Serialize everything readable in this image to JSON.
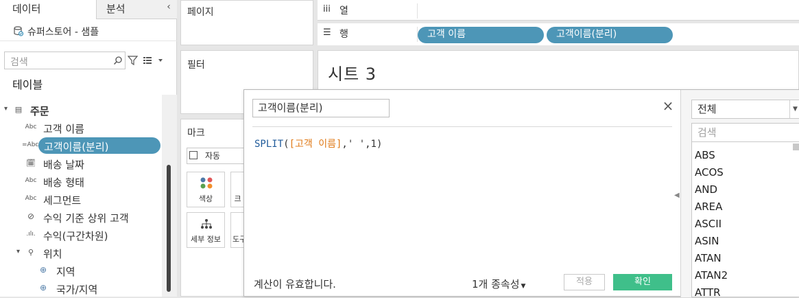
{
  "data_pane": {
    "tab_data": "데이터",
    "tab_analysis": "분석",
    "datasource": "슈퍼스토어 - 샘플",
    "search_placeholder": "검색",
    "tables_heading": "테이블",
    "items": [
      {
        "type": "folder",
        "icon": "table-icon",
        "label": "주문"
      },
      {
        "type": "Abc",
        "icon": "string-type-icon",
        "label": "고객 이름"
      },
      {
        "type": "=Abc",
        "icon": "calculated-string-icon",
        "label": "고객이름(분리)",
        "selected": true
      },
      {
        "type": "date",
        "icon": "calendar-icon",
        "label": "배송 날짜"
      },
      {
        "type": "Abc",
        "icon": "string-type-icon",
        "label": "배송 형태"
      },
      {
        "type": "Abc",
        "icon": "string-type-icon",
        "label": "세그먼트"
      },
      {
        "type": "set",
        "icon": "set-icon",
        "label": "수익 기준 상위 고객"
      },
      {
        "type": "bin",
        "icon": "bin-icon",
        "label": "수익(구간차원)"
      },
      {
        "type": "hierarchy",
        "icon": "hierarchy-icon",
        "label": "위치"
      },
      {
        "type": "geo",
        "icon": "globe-icon",
        "label": "지역"
      },
      {
        "type": "geo",
        "icon": "globe-icon",
        "label": "국가/지역"
      }
    ]
  },
  "cards": {
    "pages": "페이지",
    "filters": "필터",
    "marks": "마크",
    "marks_type": "자동",
    "color_label": "색상",
    "size_label": "크",
    "detail_label": "세부 정보",
    "tooltip_label": "도구"
  },
  "shelves": {
    "columns_label": "열",
    "columns_icon": "iii",
    "rows_label": "행",
    "rows_icon": "☰",
    "row_pills": [
      "고객 이름",
      "고객이름(분리)"
    ]
  },
  "sheet": {
    "title": "시트 3"
  },
  "calc_editor": {
    "name": "고객이름(분리)",
    "formula_fn": "SPLIT",
    "formula_open": "(",
    "formula_field": "[고객 이름]",
    "formula_rest": ",' ',1)",
    "validity": "계산이 유효합니다.",
    "dependencies": "1개 종속성",
    "apply": "적용",
    "ok": "확인",
    "accent_ok": "#3fbf8a"
  },
  "function_panel": {
    "category": "전체",
    "search_placeholder": "검색",
    "functions": [
      "ABS",
      "ACOS",
      "AND",
      "AREA",
      "ASCII",
      "ASIN",
      "ATAN",
      "ATAN2",
      "ATTR"
    ]
  },
  "colors": {
    "pill": "#4d96b7",
    "field_orange": "#e07b1a",
    "fn_blue": "#1f5a9a"
  }
}
